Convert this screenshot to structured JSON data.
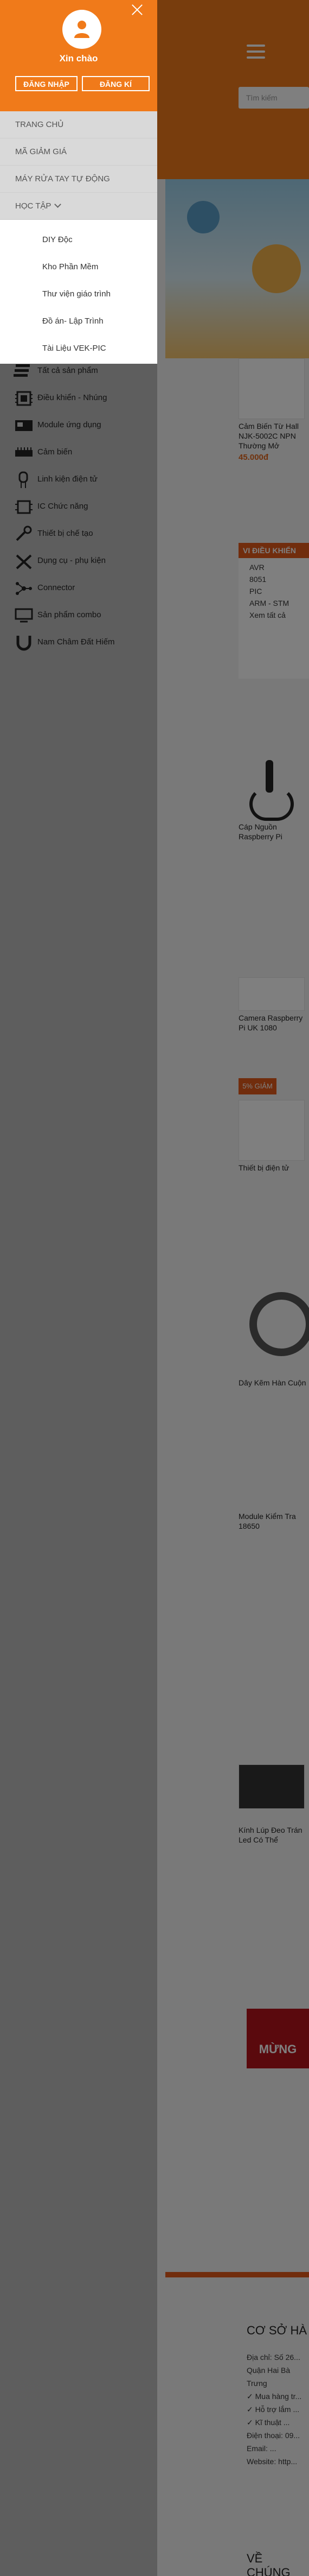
{
  "drawer": {
    "greeting": "Xin chào",
    "login_label": "ĐĂNG NHẬP",
    "register_label": "ĐĂNG KÍ",
    "menu": [
      {
        "label": "TRANG CHỦ"
      },
      {
        "label": "MÃ GIẢM GIÁ"
      },
      {
        "label": "MÁY RỬA TAY TỰ ĐỘNG"
      },
      {
        "label": "HỌC TẬP"
      }
    ],
    "submenu": [
      {
        "label": "DIY Độc"
      },
      {
        "label": "Kho Phần Mềm"
      },
      {
        "label": "Thư viện giáo trình"
      },
      {
        "label": "Đồ án- Lập Trình"
      },
      {
        "label": "Tài Liệu VEK-PIC"
      }
    ],
    "categories": [
      {
        "label": "Tất cả sản phẩm",
        "icon": "list-icon"
      },
      {
        "label": "Điều khiển - Nhúng",
        "icon": "chip-icon"
      },
      {
        "label": "Module ứng dụng",
        "icon": "module-icon"
      },
      {
        "label": "Cảm biến",
        "icon": "sensor-icon"
      },
      {
        "label": "Linh kiện điện tử",
        "icon": "component-icon"
      },
      {
        "label": "IC Chức năng",
        "icon": "ic-icon"
      },
      {
        "label": "Thiết bị chế tạo",
        "icon": "tool-icon"
      },
      {
        "label": "Dụng cụ - phụ kiện",
        "icon": "wrench-icon"
      },
      {
        "label": "Connector",
        "icon": "connector-icon"
      },
      {
        "label": "Sản phẩm combo",
        "icon": "combo-icon"
      },
      {
        "label": "Nam Châm Đất Hiếm",
        "icon": "magnet-icon"
      }
    ]
  },
  "header": {
    "search_placeholder": "Tìm kiếm"
  },
  "products": [
    {
      "name": "Cảm Biến Từ Hall NJK-5002C NPN Thường Mở",
      "price": "45.000đ"
    },
    {
      "name": "Cáp Nguồn Raspberry Pi",
      "price": ""
    },
    {
      "name": "Camera Raspberry Pi UK 1080",
      "price": ""
    },
    {
      "name": "Thiết bị điện tử",
      "price": ""
    },
    {
      "name": "Dây Kẽm Hàn Cuộn",
      "price": ""
    },
    {
      "name": "Module Kiểm Tra 18650",
      "price": ""
    },
    {
      "name": "Kính Lúp Đeo Trán Led Có Thể",
      "price": ""
    }
  ],
  "promo": {
    "badge": "VI ĐIỀU KHIỂN",
    "discount": "5% GIẢM",
    "items": [
      "AVR",
      "8051",
      "PIC",
      "ARM - STM"
    ],
    "see_all": "Xem tất cả"
  },
  "footer": {
    "banner_title": "MỪNG",
    "section_title": "CƠ SỞ HÀ",
    "lines": [
      "Địa chỉ: Số 26...",
      "Quận Hai Bà Trưng",
      "✓ Mua hàng tr...",
      "✓ Hỗ trợ lắm ...",
      "✓ Kĩ thuật ...",
      "Điện thoại: 09...",
      "Email: ...",
      "Website: http..."
    ],
    "bottom_title": "VỀ CHÚNG"
  },
  "colors": {
    "brand_orange": "#f07a1a",
    "menu_bg": "#d9d9d9",
    "drawer_bg": "#5e5e5e",
    "overlay": "rgba(0,0,0,0.5)"
  }
}
